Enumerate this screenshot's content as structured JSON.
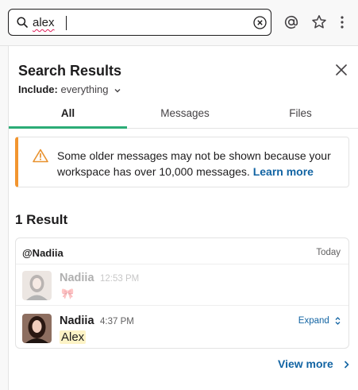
{
  "search": {
    "query": "alex"
  },
  "panel": {
    "title": "Search Results",
    "include_label": "Include:",
    "include_value": "everything",
    "tabs": [
      {
        "label": "All"
      },
      {
        "label": "Messages"
      },
      {
        "label": "Files"
      }
    ]
  },
  "notice": {
    "text": "Some older messages may not be shown because your workspace has over 10,000 messages.",
    "link": "Learn more"
  },
  "results": {
    "count_label": "1 Result",
    "channel": "@Nadiia",
    "date": "Today",
    "messages": [
      {
        "author": "Nadiia",
        "time": "12:53 PM",
        "body": "🎀"
      },
      {
        "author": "Nadiia",
        "time": "4:37 PM",
        "body": "Alex",
        "expand": "Expand"
      }
    ],
    "view_more": "View more"
  },
  "colors": {
    "accent_tab": "#2bac76",
    "warning": "#f2952f",
    "link": "#1264a3",
    "highlight": "#fdf3c6"
  }
}
